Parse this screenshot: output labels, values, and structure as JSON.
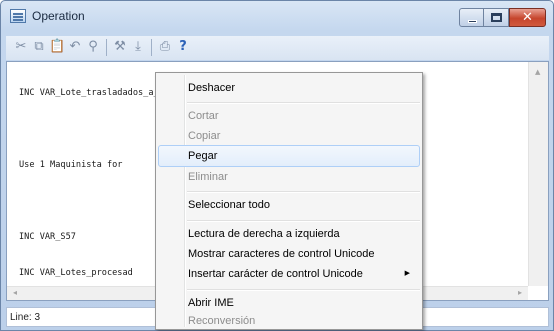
{
  "window": {
    "title": "Operation"
  },
  "toolbar": {
    "icons": [
      "cut-icon",
      "copy-icon",
      "paste-icon",
      "undo-icon",
      "find-icon",
      "tools-icon",
      "insert-icon",
      "print-icon",
      "help-icon"
    ]
  },
  "editor": {
    "lines": [
      "INC VAR_Lote_trasladados_a_la_estacion",
      "",
      "Use 1 Maquinista for",
      "",
      "INC VAR_S57",
      "INC VAR_Lotes_procesad"
    ]
  },
  "status": {
    "text": "Line: 3"
  },
  "context_menu": {
    "items": [
      {
        "label": "Deshacer",
        "enabled": true
      },
      {
        "label": "Cortar",
        "enabled": false
      },
      {
        "label": "Copiar",
        "enabled": false
      },
      {
        "label": "Pegar",
        "enabled": true,
        "highlighted": true
      },
      {
        "label": "Eliminar",
        "enabled": false
      },
      {
        "label": "Seleccionar todo",
        "enabled": true
      },
      {
        "label": "Lectura de derecha a izquierda",
        "enabled": true
      },
      {
        "label": "Mostrar caracteres de control Unicode",
        "enabled": true
      },
      {
        "label": "Insertar carácter de control Unicode",
        "enabled": true,
        "submenu": true
      },
      {
        "label": "Abrir IME",
        "enabled": true
      },
      {
        "label": "Reconversión",
        "enabled": false
      }
    ]
  }
}
